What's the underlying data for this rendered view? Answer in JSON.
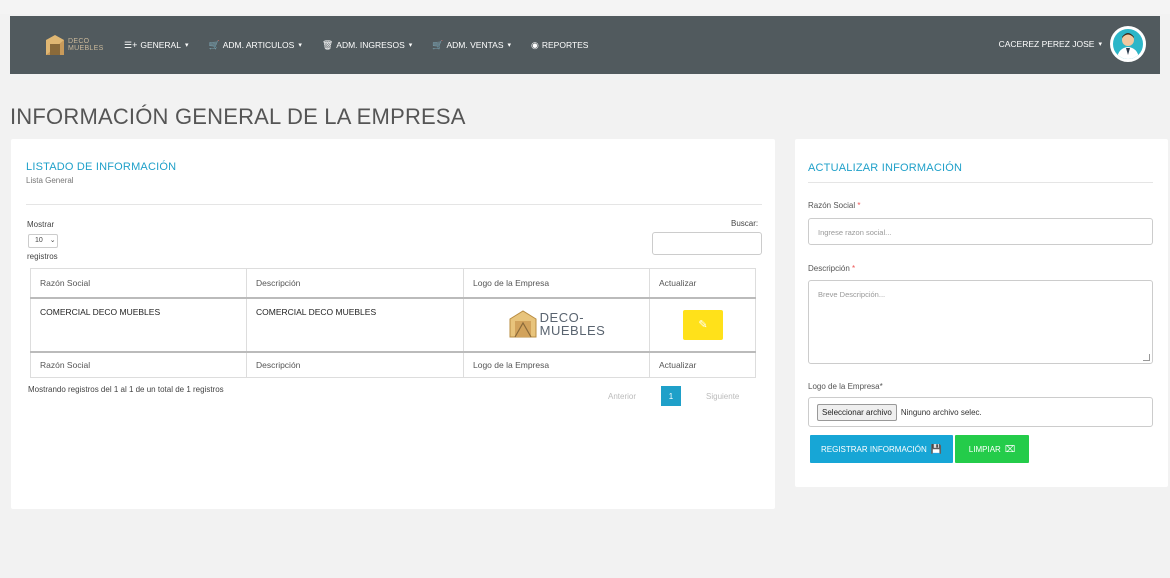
{
  "nav": {
    "brand": {
      "line1": "DECO",
      "line2": "MUEBLES"
    },
    "items": [
      {
        "label": "GENERAL",
        "icon": "list-plus-icon",
        "glyph": "☰+",
        "caret": "▾"
      },
      {
        "label": "ADM. ARTICULOS",
        "icon": "cart-icon",
        "glyph": "🛒",
        "caret": "▾"
      },
      {
        "label": "ADM. INGRESOS",
        "icon": "basket-icon",
        "glyph": "🗑",
        "caret": "▾"
      },
      {
        "label": "ADM. VENTAS",
        "icon": "cart-icon",
        "glyph": "🛒",
        "caret": "▾"
      },
      {
        "label": "REPORTES",
        "icon": "eye-icon",
        "glyph": "◉",
        "caret": ""
      }
    ],
    "user": "CACEREZ PEREZ JOSE",
    "user_caret": "▾"
  },
  "page": {
    "title": "INFORMACIÓN GENERAL DE LA EMPRESA"
  },
  "list": {
    "title": "LISTADO DE INFORMACIÓN",
    "subtitle": "Lista General",
    "show_label": "Mostrar",
    "page_size": "10",
    "records_label": "registros",
    "search_label": "Buscar:",
    "columns": [
      "Razón Social",
      "Descripción",
      "Logo de la Empresa",
      "Actualizar"
    ],
    "rows": [
      {
        "razon_social": "COMERCIAL DECO MUEBLES",
        "descripcion": "COMERCIAL DECO MUEBLES",
        "logo_line1": "DECO-",
        "logo_line2": "MUEBLES"
      }
    ],
    "info": "Mostrando registros del 1 al 1 de un total de 1 registros",
    "pagination": {
      "prev": "Anterior",
      "current": "1",
      "next": "Siguiente"
    }
  },
  "form": {
    "title": "ACTUALIZAR INFORMACIÓN",
    "razon_label": "Razón Social",
    "razon_placeholder": "Ingrese razon social...",
    "desc_label": "Descripción",
    "desc_placeholder": "Breve Descripción...",
    "logo_label": "Logo de la Empresa*",
    "file_button": "Seleccionar archivo",
    "file_status": "Ninguno archivo selec.",
    "required_mark": "*",
    "register_button": "REGISTRAR INFORMACIÓN",
    "clear_button": "LIMPIAR"
  },
  "colors": {
    "navbar": "#515a5e",
    "accent": "#1fa0c9",
    "edit": "#ffe11a",
    "register": "#17a6d6",
    "clear": "#24cc4a"
  }
}
